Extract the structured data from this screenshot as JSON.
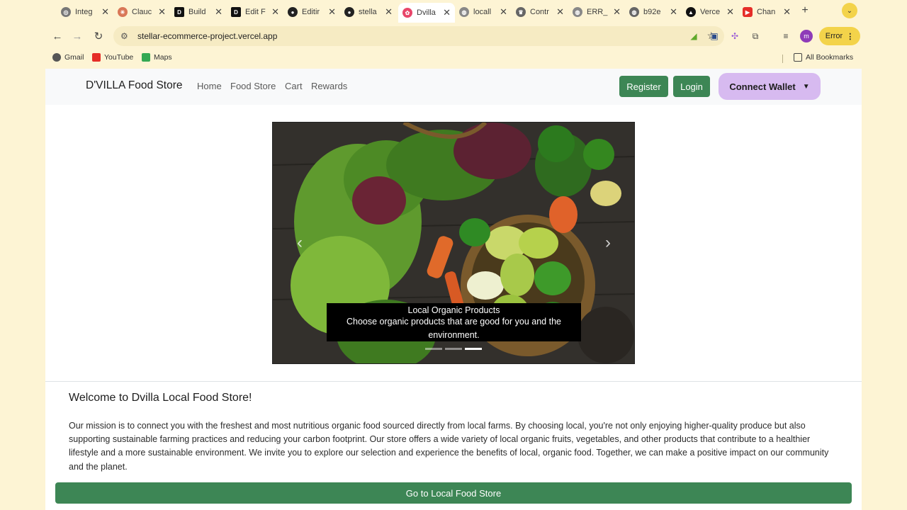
{
  "tabs": [
    {
      "title": "Integ",
      "icon": "openai-icon",
      "color": "#555555"
    },
    {
      "title": "Clauc",
      "icon": "claude-icon",
      "color": "#d97757"
    },
    {
      "title": "Build",
      "icon": "dev-icon",
      "color": "#111111"
    },
    {
      "title": "Edit F",
      "icon": "dev-icon",
      "color": "#111111"
    },
    {
      "title": "Editir",
      "icon": "github-icon",
      "color": "#222222"
    },
    {
      "title": "stella",
      "icon": "github-icon",
      "color": "#222222"
    },
    {
      "title": "Dvilla",
      "icon": "dvilla-icon",
      "color": "#e8466a",
      "active": true
    },
    {
      "title": "locall",
      "icon": "globe-icon",
      "color": "#777777"
    },
    {
      "title": "Contr",
      "icon": "crown-icon",
      "color": "#555555"
    },
    {
      "title": "ERR_",
      "icon": "globe-icon",
      "color": "#777777"
    },
    {
      "title": "b92e",
      "icon": "globe-icon",
      "color": "#555555"
    },
    {
      "title": "Verce",
      "icon": "vercel-icon",
      "color": "#111111"
    },
    {
      "title": "Chan",
      "icon": "youtube-icon",
      "color": "#e52d27"
    }
  ],
  "toolbar": {
    "url": "stellar-ecommerce-project.vercel.app",
    "profile_initial": "m",
    "error_label": "Error"
  },
  "bookmarks": {
    "items": [
      {
        "label": "Gmail",
        "color": "#555555"
      },
      {
        "label": "YouTube",
        "color": "#e52d27"
      },
      {
        "label": "Maps",
        "color": "#34a853"
      }
    ],
    "all_label": "All Bookmarks"
  },
  "navbar": {
    "brand": "D'VILLA Food Store",
    "links": [
      "Home",
      "Food Store",
      "Cart",
      "Rewards"
    ],
    "register_label": "Register",
    "login_label": "Login",
    "wallet_label": "Connect Wallet"
  },
  "carousel": {
    "caption_title": "Local Organic Products",
    "caption_text": "Choose organic products that are good for you and the environment.",
    "slide_count": 3,
    "active_slide": 3
  },
  "welcome": {
    "title": "Welcome to Dvilla Local Food Store!",
    "text": "Our mission is to connect you with the freshest and most nutritious organic food sourced directly from local farms. By choosing local, you're not only enjoying higher-quality produce but also supporting sustainable farming practices and reducing your carbon footprint. Our store offers a wide variety of local organic fruits, vegetables, and other products that contribute to a healthier lifestyle and a more sustainable environment. We invite you to explore our selection and experience the benefits of local, organic food. Together, we can make a positive impact on our community and the planet.",
    "button_label": "Go to Local Food Store"
  },
  "colors": {
    "accent_green": "#3d8655",
    "wallet_purple": "#d7baf0",
    "chrome_yellow": "#fdf4d4"
  }
}
